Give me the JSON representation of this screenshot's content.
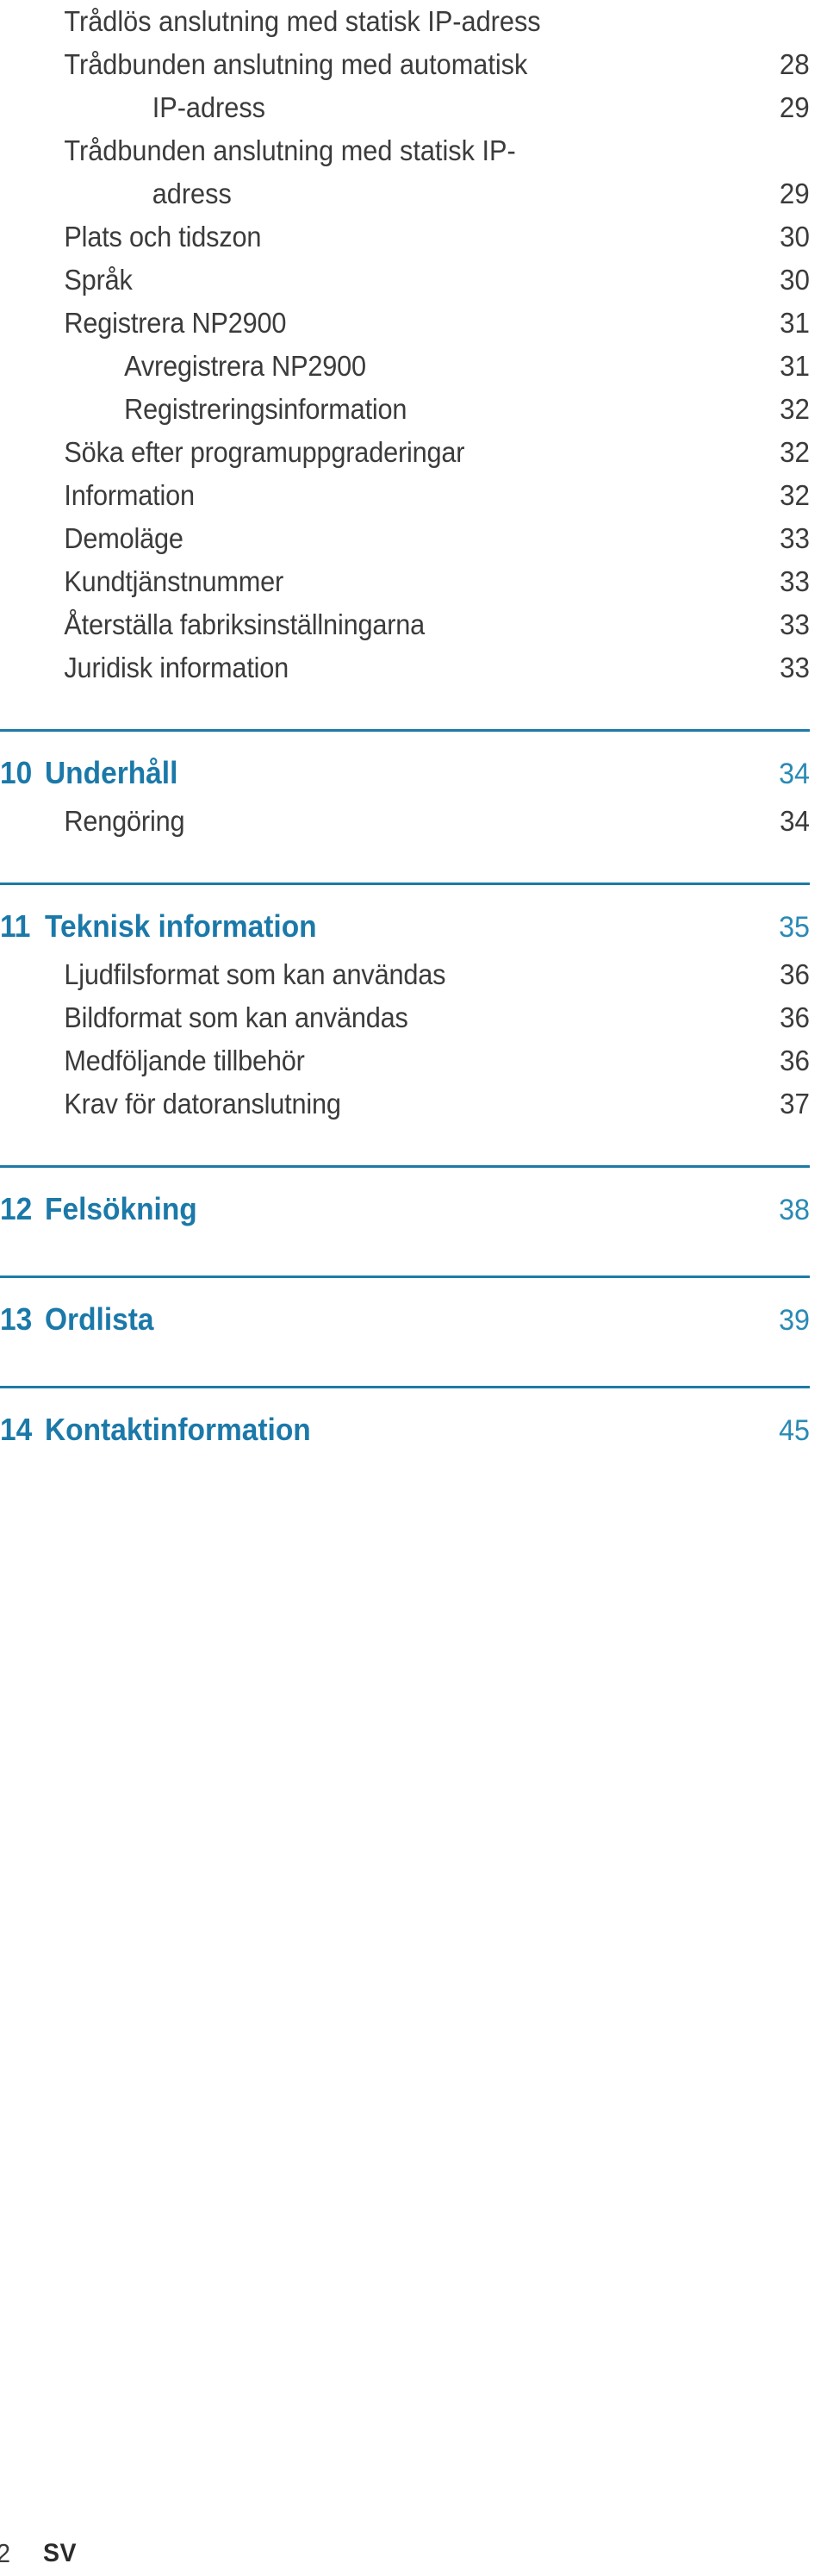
{
  "document": {
    "type": "table-of-contents",
    "language_code": "SV",
    "footer_page_number": "2"
  },
  "colors": {
    "accent_blue": "#1b79a9",
    "rule_blue": "#1e7aa6",
    "body_text": "#3b3b3b",
    "background": "#ffffff"
  },
  "continued_entries": [
    {
      "line1": "Trådlös anslutning med statisk IP-adress",
      "line2": "",
      "page": "28",
      "indent": 1
    },
    {
      "line1": "Trådbunden anslutning med automatisk",
      "line2": "IP-adress",
      "page": "29",
      "indent": 1
    },
    {
      "line1": "Trådbunden anslutning med statisk IP-",
      "line2": "adress",
      "page": "29",
      "indent": 1
    }
  ],
  "entries": [
    {
      "label": "Plats och tidszon",
      "page": "30",
      "indent": 1
    },
    {
      "label": "Språk",
      "page": "30",
      "indent": 1
    },
    {
      "label": "Registrera NP2900",
      "page": "31",
      "indent": 1
    },
    {
      "label": "Avregistrera NP2900",
      "page": "31",
      "indent": 2
    },
    {
      "label": "Registreringsinformation",
      "page": "32",
      "indent": 2
    },
    {
      "label": "Söka efter programuppgraderingar",
      "page": "32",
      "indent": 1
    },
    {
      "label": "Information",
      "page": "32",
      "indent": 1
    },
    {
      "label": "Demoläge",
      "page": "33",
      "indent": 1
    },
    {
      "label": "Kundtjänstnummer",
      "page": "33",
      "indent": 1
    },
    {
      "label": "Återställa fabriksinställningarna",
      "page": "33",
      "indent": 1
    },
    {
      "label": "Juridisk information",
      "page": "33",
      "indent": 1
    }
  ],
  "chapters": [
    {
      "number": "10",
      "title": "Underhåll",
      "page": "34",
      "children": [
        {
          "label": "Rengöring",
          "page": "34",
          "indent": 1
        }
      ]
    },
    {
      "number": "11",
      "title": "Teknisk information",
      "page": "35",
      "children": [
        {
          "label": "Ljudfilsformat som kan användas",
          "page": "36",
          "indent": 1
        },
        {
          "label": "Bildformat som kan användas",
          "page": "36",
          "indent": 1
        },
        {
          "label": "Medföljande tillbehör",
          "page": "36",
          "indent": 1
        },
        {
          "label": "Krav för datoranslutning",
          "page": "37",
          "indent": 1
        }
      ]
    },
    {
      "number": "12",
      "title": "Felsökning",
      "page": "38",
      "children": []
    },
    {
      "number": "13",
      "title": "Ordlista",
      "page": "39",
      "children": []
    },
    {
      "number": "14",
      "title": "Kontaktinformation",
      "page": "45",
      "children": []
    }
  ]
}
